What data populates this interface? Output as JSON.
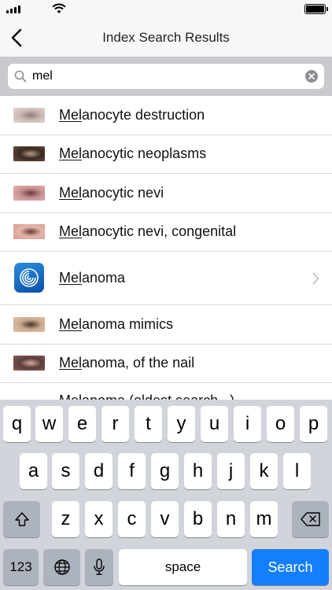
{
  "status_bar": {
    "signal_bars": 4,
    "battery_level": 1.0
  },
  "nav": {
    "title": "Index Search Results"
  },
  "search": {
    "query": "mel"
  },
  "results": [
    {
      "hl": "Mel",
      "rest": "anocyte destruction",
      "thumb_colors": [
        "#c9b8b4",
        "#8e7a78",
        "#e4d8d4"
      ]
    },
    {
      "hl": "Mel",
      "rest": "anocytic neoplasms",
      "thumb_colors": [
        "#3a2a22",
        "#b69c84",
        "#6b4f3e"
      ]
    },
    {
      "hl": "Mel",
      "rest": "anocytic nevi",
      "thumb_colors": [
        "#c68f8f",
        "#6e3b43",
        "#e1b5b3"
      ]
    },
    {
      "hl": "Mel",
      "rest": "anocytic nevi, congenital",
      "thumb_colors": [
        "#e4b6aa",
        "#6a3a34",
        "#d89a8d"
      ]
    },
    {
      "hl": "Mel",
      "rest": "anoma",
      "is_app_entry": true
    },
    {
      "hl": "Mel",
      "rest": "anoma mimics",
      "thumb_colors": [
        "#c9a98e",
        "#4a3426",
        "#dfc4ad"
      ]
    },
    {
      "hl": "Mel",
      "rest": "anoma, of the nail",
      "thumb_colors": [
        "#5a3e3a",
        "#d8a7a0",
        "#8c5a52"
      ]
    }
  ],
  "partial_result": {
    "text": "Melanoma (oldest search...)"
  },
  "keyboard": {
    "row1": [
      "q",
      "w",
      "e",
      "r",
      "t",
      "y",
      "u",
      "i",
      "o",
      "p"
    ],
    "row2": [
      "a",
      "s",
      "d",
      "f",
      "g",
      "h",
      "j",
      "k",
      "l"
    ],
    "row3": [
      "z",
      "x",
      "c",
      "v",
      "b",
      "n",
      "m"
    ],
    "numbers_label": "123",
    "space_label": "space",
    "search_label": "Search"
  },
  "colors": {
    "accent": "#147efb",
    "nav_bg": "#f7f7f7",
    "search_bg": "#c9c9ce",
    "keyboard_bg": "#d1d4da"
  }
}
